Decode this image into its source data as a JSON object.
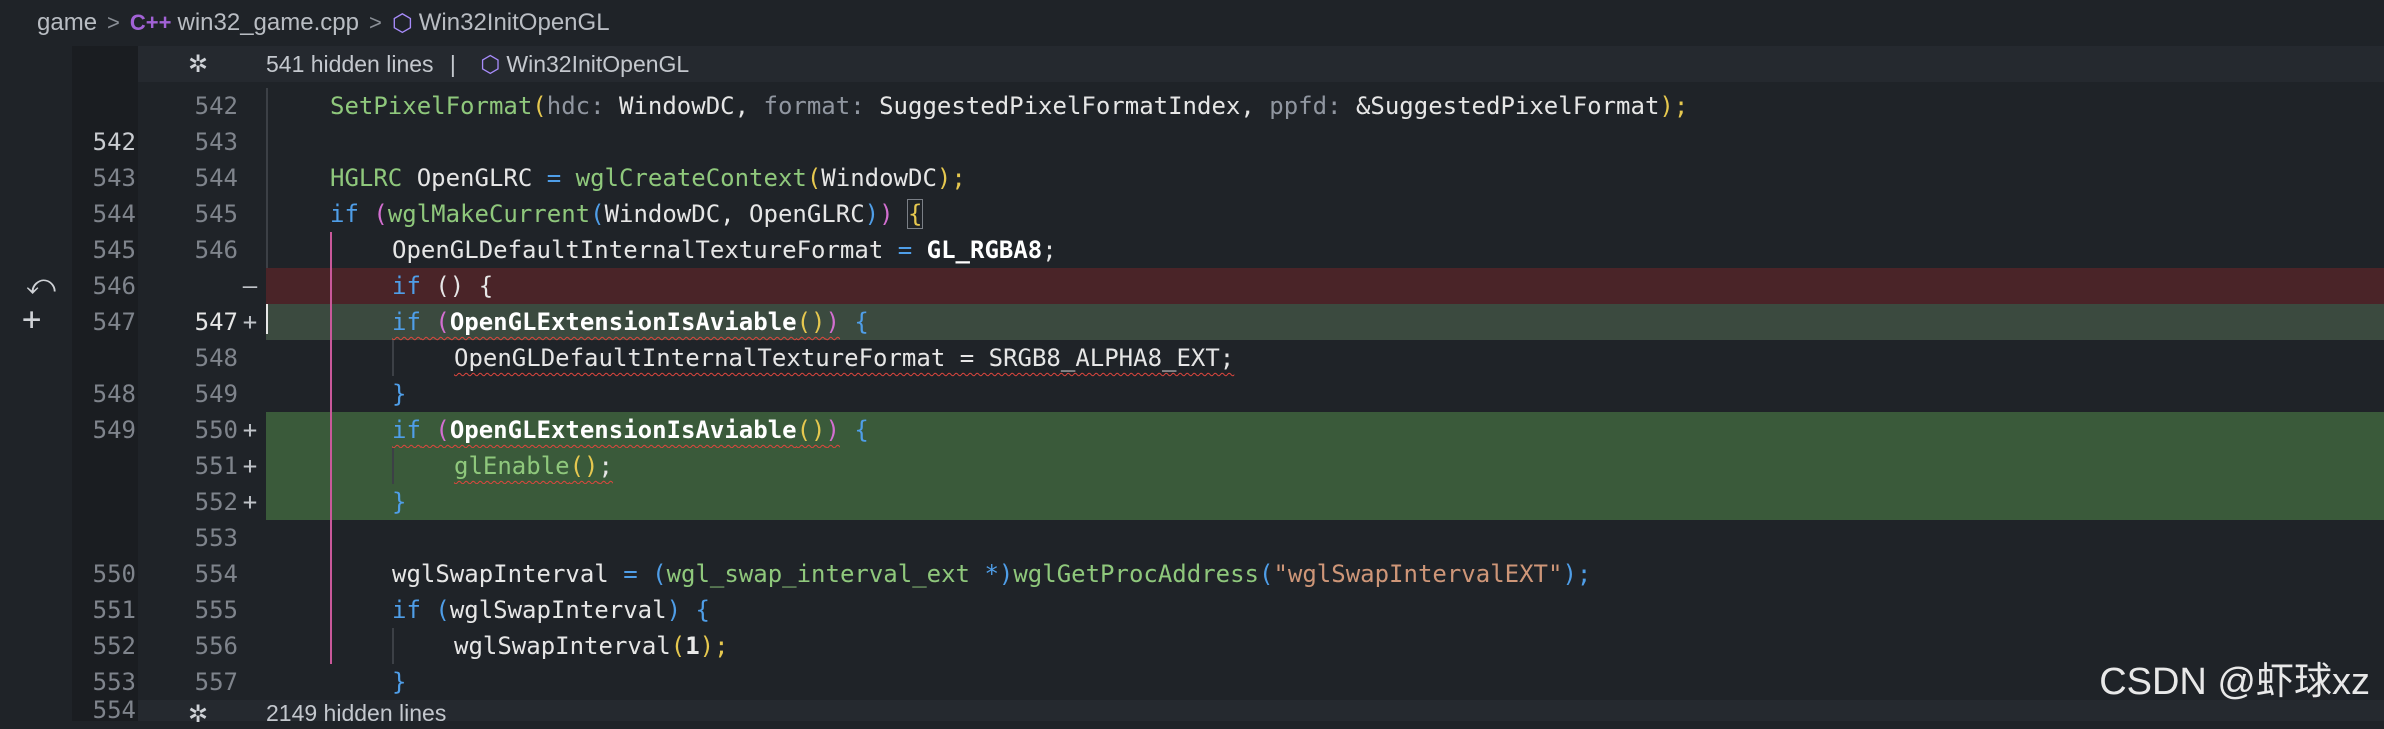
{
  "breadcrumb": {
    "folder": "game",
    "file": "win32_game.cpp",
    "symbol": "Win32InitOpenGL"
  },
  "fold_top": {
    "text": "541 hidden lines",
    "separator": "|",
    "symbol": "Win32InitOpenGL"
  },
  "fold_bottom": {
    "old_line": "554",
    "text": "2149 hidden lines"
  },
  "rows": [
    {
      "old": "",
      "new": "542",
      "mark": "",
      "active_old": false,
      "active_new": false
    },
    {
      "old": "542",
      "new": "543",
      "mark": "",
      "active_old": true,
      "active_new": false
    },
    {
      "old": "543",
      "new": "544",
      "mark": "",
      "active_old": false,
      "active_new": false
    },
    {
      "old": "544",
      "new": "545",
      "mark": "",
      "active_old": false,
      "active_new": false
    },
    {
      "old": "545",
      "new": "546",
      "mark": "",
      "active_old": false,
      "active_new": false
    },
    {
      "old": "546",
      "new": "",
      "mark": "—",
      "active_old": false,
      "active_new": false
    },
    {
      "old": "547",
      "new": "547",
      "mark": "+",
      "active_old": false,
      "active_new": true
    },
    {
      "old": "",
      "new": "548",
      "mark": "",
      "active_old": false,
      "active_new": false
    },
    {
      "old": "548",
      "new": "549",
      "mark": "",
      "active_old": false,
      "active_new": false
    },
    {
      "old": "549",
      "new": "550",
      "mark": "+",
      "active_old": false,
      "active_new": false
    },
    {
      "old": "",
      "new": "551",
      "mark": "+",
      "active_old": false,
      "active_new": false
    },
    {
      "old": "",
      "new": "552",
      "mark": "+",
      "active_old": false,
      "active_new": false
    },
    {
      "old": "",
      "new": "553",
      "mark": "",
      "active_old": false,
      "active_new": false
    },
    {
      "old": "550",
      "new": "554",
      "mark": "",
      "active_old": false,
      "active_new": false
    },
    {
      "old": "551",
      "new": "555",
      "mark": "",
      "active_old": false,
      "active_new": false
    },
    {
      "old": "552",
      "new": "556",
      "mark": "",
      "active_old": false,
      "active_new": false
    },
    {
      "old": "553",
      "new": "557",
      "mark": "",
      "active_old": false,
      "active_new": false
    }
  ],
  "code": {
    "l542": {
      "fn": "SetPixelFormat",
      "hint1": "hdc:",
      "arg1": "WindowDC,",
      "hint2": "format:",
      "arg2": "SuggestedPixelFormatIndex,",
      "hint3": "ppfd:",
      "amp": "&",
      "arg3": "SuggestedPixelFormat",
      "end": ");"
    },
    "l544": {
      "type": "HGLRC",
      "var": "OpenGLRC",
      "eq": "=",
      "fn": "wglCreateContext",
      "arg": "WindowDC",
      "end": ");"
    },
    "l545": {
      "kw": "if",
      "fn": "wglMakeCurrent",
      "args": "WindowDC, OpenGLRC",
      "brace": "{"
    },
    "l546": {
      "var": "OpenGLDefaultInternalTextureFormat",
      "eq": "=",
      "val": "GL_RGBA8",
      "end": ";"
    },
    "del": {
      "kw": "if",
      "rest": "() {"
    },
    "l547": {
      "kw": "if",
      "fn": "OpenGLExtensionIsAviable",
      "call": "()",
      "brace": "{"
    },
    "l548": {
      "text": "OpenGLDefaultInternalTextureFormat = SRGB8_ALPHA8_EXT;"
    },
    "l549": {
      "brace": "}"
    },
    "l550": {
      "kw": "if",
      "fn": "OpenGLExtensionIsAviable",
      "call": "()",
      "brace": "{"
    },
    "l551": {
      "fn": "glEnable",
      "call": "()",
      "end": ";"
    },
    "l552": {
      "brace": "}"
    },
    "l554": {
      "var": "wglSwapInterval",
      "eq": "=",
      "cast": "wgl_swap_interval_ext",
      "star": "*",
      "fn": "wglGetProcAddress",
      "str": "\"wglSwapIntervalEXT\"",
      "end": ");"
    },
    "l555": {
      "kw": "if",
      "arg": "wglSwapInterval",
      "brace": "{"
    },
    "l556": {
      "fn": "wglSwapInterval",
      "num": "1",
      "end": ");"
    },
    "l557": {
      "brace": "}"
    }
  },
  "watermark": "CSDN @虾球xz",
  "colors": {
    "deleted_line_bg": "#4a2428",
    "added_line_bg": "#3a5a3a",
    "function": "#8fc87c",
    "keyword": "#4f9ee8",
    "string": "#ce9678",
    "error_squiggle": "#e0463d"
  },
  "icons": [
    "cpp-file-icon",
    "symbol-cube-icon",
    "fold-gear-icon",
    "revert-icon",
    "add-icon"
  ]
}
